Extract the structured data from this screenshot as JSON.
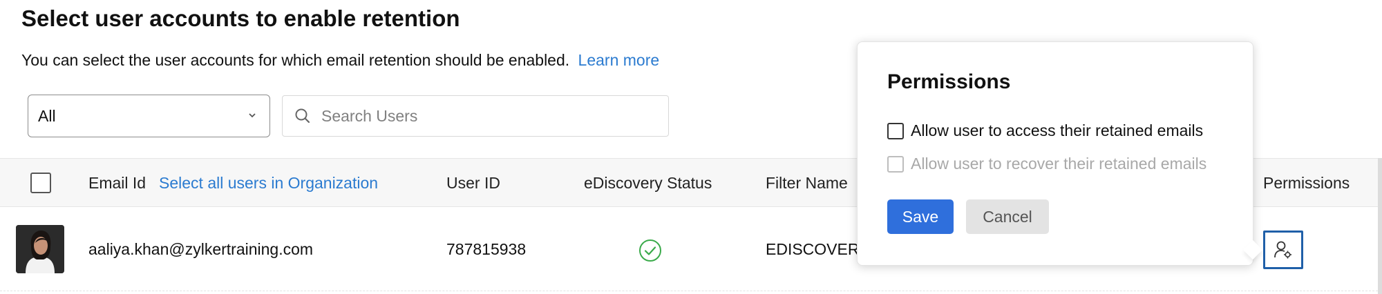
{
  "page": {
    "title": "Select user accounts to enable retention",
    "description": "You can select the user accounts for which email retention should be enabled.",
    "learn_more": "Learn more"
  },
  "filters": {
    "selected": "All",
    "search_placeholder": "Search Users"
  },
  "table": {
    "columns": {
      "email": "Email Id",
      "select_all": "Select all users in Organization",
      "user_id": "User ID",
      "ediscovery": "eDiscovery Status",
      "filter_name": "Filter Name",
      "permissions": "Permissions"
    },
    "rows": [
      {
        "email": "aaliya.khan@zylkertraining.com",
        "user_id": "787815938",
        "ediscovery_status_icon": "check-circle-icon",
        "filter_name": "EDISCOVER"
      }
    ]
  },
  "popover": {
    "title": "Permissions",
    "option_access": "Allow user to access their retained emails",
    "option_recover": "Allow user to recover their retained emails",
    "save": "Save",
    "cancel": "Cancel"
  },
  "colors": {
    "accent": "#2b7bd0",
    "primary_button": "#2f6fdc",
    "success": "#3aaa4a",
    "focus_border": "#1f5fa8"
  }
}
